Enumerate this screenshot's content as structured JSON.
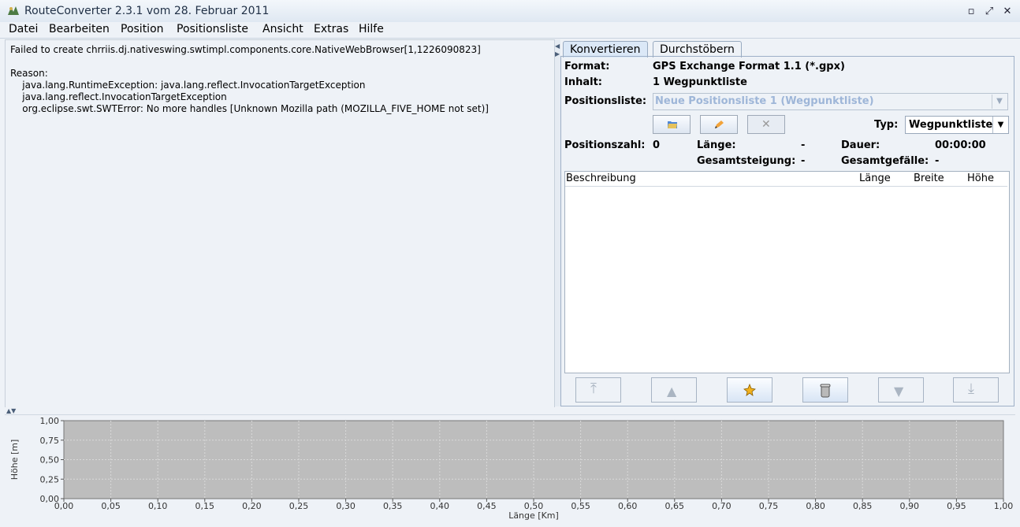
{
  "window": {
    "title": "RouteConverter 2.3.1 vom 28. Februar 2011"
  },
  "menus": [
    {
      "label": "Datei",
      "accel": "D"
    },
    {
      "label": "Bearbeiten",
      "accel": "B"
    },
    {
      "label": "Position",
      "accel": "P"
    },
    {
      "label": "Positionsliste",
      "accel": "l"
    },
    {
      "label": "Ansicht",
      "accel": "A"
    },
    {
      "label": "Extras",
      "accel": "E"
    },
    {
      "label": "Hilfe",
      "accel": "H"
    }
  ],
  "errors": {
    "line1": "Failed to create chrriis.dj.nativeswing.swtimpl.components.core.NativeWebBrowser[1,1226090823]",
    "reason": "Reason:",
    "line2": "    java.lang.RuntimeException: java.lang.reflect.InvocationTargetException",
    "line3": "    java.lang.reflect.InvocationTargetException",
    "line4": "    org.eclipse.swt.SWTError: No more handles [Unknown Mozilla path (MOZILLA_FIVE_HOME not set)]"
  },
  "tabs": [
    "Konvertieren",
    "Durchstöbern"
  ],
  "details": {
    "format_label": "Format:",
    "format_value": "GPS Exchange Format 1.1 (*.gpx)",
    "inhalt_label": "Inhalt:",
    "inhalt_value": "1 Wegpunktliste",
    "positionsliste_label": "Positionsliste:",
    "positionsliste_value": "Neue Positionsliste 1 (Wegpunktliste)",
    "typ_label": "Typ:",
    "typ_value": "Wegpunktliste",
    "positionszahl_label": "Positionszahl:",
    "positionszahl_value": "0",
    "laenge_label": "Länge:",
    "laenge_value": "-",
    "dauer_label": "Dauer:",
    "dauer_value": "00:00:00",
    "gesamtsteigung_label": "Gesamtsteigung:",
    "gesamtsteigung_value": "-",
    "gesamtgefaelle_label": "Gesamtgefälle:",
    "gesamtgefaelle_value": "-"
  },
  "table": {
    "columns": [
      "Beschreibung",
      "Länge",
      "Breite",
      "Höhe"
    ]
  },
  "chart_data": {
    "type": "line",
    "xlabel": "Länge [Km]",
    "ylabel": "Höhe [m]",
    "x_ticks": [
      "0,00",
      "0,05",
      "0,10",
      "0,15",
      "0,20",
      "0,25",
      "0,30",
      "0,35",
      "0,40",
      "0,45",
      "0,50",
      "0,55",
      "0,60",
      "0,65",
      "0,70",
      "0,75",
      "0,80",
      "0,85",
      "0,90",
      "0,95",
      "1,00"
    ],
    "y_ticks": [
      "0,00",
      "0,25",
      "0,50",
      "0,75",
      "1,00"
    ],
    "xlim": [
      0,
      1
    ],
    "ylim": [
      0,
      1
    ],
    "grid": true,
    "series": []
  },
  "colors": {
    "plot_bg": "#bdbdbd",
    "grid": "#d9d9d9",
    "accent": "#dbe8f7"
  }
}
